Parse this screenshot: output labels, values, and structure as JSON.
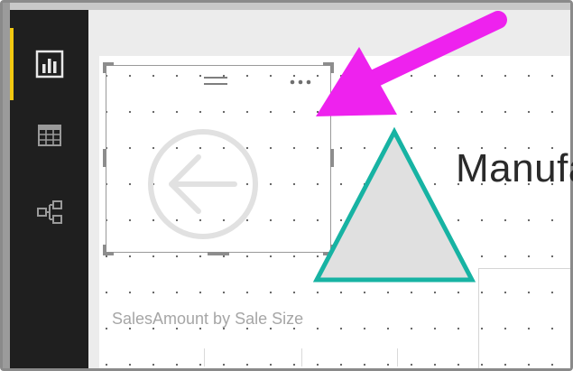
{
  "nav": {
    "items": [
      {
        "name": "report-view",
        "icon": "bar-chart-icon",
        "active": true
      },
      {
        "name": "data-view",
        "icon": "table-grid-icon",
        "active": false
      },
      {
        "name": "model-view",
        "icon": "relationship-icon",
        "active": false
      }
    ],
    "accent_color": "#f2c811"
  },
  "canvas": {
    "image_visual": {
      "icon": "arrow-left-circle-icon",
      "selected": true
    },
    "shape": {
      "type": "triangle",
      "fill": "#e0e0e0",
      "stroke": "#17b3a3"
    },
    "title_text": "Manufa",
    "chart_title": "SalesAmount by Sale Size"
  },
  "annotation": {
    "type": "arrow",
    "color": "#ee22ee"
  },
  "visual_header": {
    "drag_grip": "drag-grip-icon",
    "more_options": "more-options-icon"
  }
}
